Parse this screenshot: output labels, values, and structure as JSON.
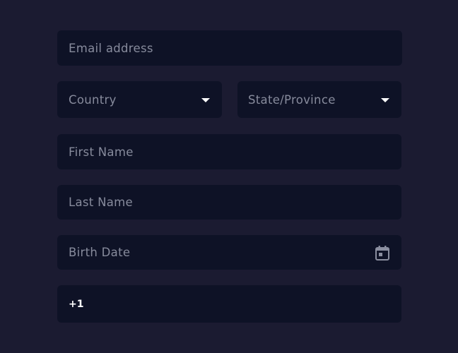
{
  "form": {
    "email": {
      "placeholder": "Email address"
    },
    "country": {
      "placeholder": "Country",
      "icon": "chevron-down-icon"
    },
    "state": {
      "placeholder": "State/Province",
      "icon": "chevron-down-icon"
    },
    "first_name": {
      "placeholder": "First Name"
    },
    "last_name": {
      "placeholder": "Last Name"
    },
    "birth_date": {
      "placeholder": "Birth Date",
      "icon": "calendar-icon"
    },
    "phone": {
      "prefix": "+1"
    }
  },
  "colors": {
    "background": "#1b1b31",
    "field_background": "#0e1226",
    "placeholder_text": "#878b9c",
    "icon": "#ffffff",
    "calendar_icon": "#8a8e9f"
  }
}
